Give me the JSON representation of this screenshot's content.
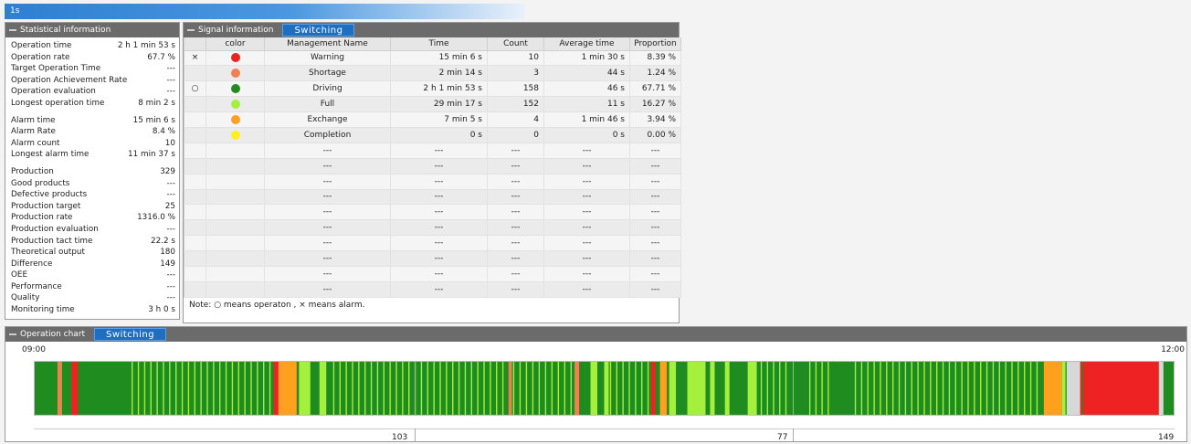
{
  "topbar": {
    "label": "1s"
  },
  "stats": {
    "title": "Statistical information",
    "rows": [
      {
        "label": "Operation time",
        "value": "2 h 1 min 53 s"
      },
      {
        "label": "Operation rate",
        "value": "67.7 %"
      },
      {
        "label": "Target Operation Time",
        "value": "---"
      },
      {
        "label": "Operation Achievement Rate",
        "value": "---"
      },
      {
        "label": "Operation evaluation",
        "value": "---"
      },
      {
        "label": "Longest operation time",
        "value": "8 min 2 s"
      },
      {
        "label": "Alarm time",
        "value": "15 min 6 s"
      },
      {
        "label": "Alarm Rate",
        "value": "8.4 %"
      },
      {
        "label": "Alarm count",
        "value": "10"
      },
      {
        "label": "Longest alarm time",
        "value": "11 min 37 s"
      },
      {
        "label": "Production",
        "value": "329"
      },
      {
        "label": "Good products",
        "value": "---"
      },
      {
        "label": "Defective products",
        "value": "---"
      },
      {
        "label": "Production target",
        "value": "25"
      },
      {
        "label": "Production rate",
        "value": "1316.0 %"
      },
      {
        "label": "Production evaluation",
        "value": "---"
      },
      {
        "label": "Production tact time",
        "value": "22.2 s"
      },
      {
        "label": "Theoretical output",
        "value": "180"
      },
      {
        "label": "Difference",
        "value": "149"
      },
      {
        "label": "OEE",
        "value": "---"
      },
      {
        "label": "Performance",
        "value": "---"
      },
      {
        "label": "Quality",
        "value": "---"
      },
      {
        "label": "Monitoring time",
        "value": "3 h 0 s"
      }
    ]
  },
  "signal": {
    "title": "Signal information",
    "switch_label": "Switching",
    "headers": [
      "",
      "color",
      "Management Name",
      "Time",
      "Count",
      "Average time",
      "Proportion"
    ],
    "rows": [
      {
        "mark": "×",
        "color": "#ee2222",
        "name": "Warning",
        "time": "15 min 6 s",
        "count": "10",
        "avg": "1 min 30 s",
        "prop": "8.39 %"
      },
      {
        "mark": "",
        "color": "#f08050",
        "name": "Shortage",
        "time": "2 min 14 s",
        "count": "3",
        "avg": "44 s",
        "prop": "1.24 %"
      },
      {
        "mark": "○",
        "color": "#1e8c1e",
        "name": "Driving",
        "time": "2 h 1 min 53 s",
        "count": "158",
        "avg": "46 s",
        "prop": "67.71 %"
      },
      {
        "mark": "",
        "color": "#a4f03c",
        "name": "Full",
        "time": "29 min 17 s",
        "count": "152",
        "avg": "11 s",
        "prop": "16.27 %"
      },
      {
        "mark": "",
        "color": "#ffa01e",
        "name": "Exchange",
        "time": "7 min 5 s",
        "count": "4",
        "avg": "1 min 46 s",
        "prop": "3.94 %"
      },
      {
        "mark": "",
        "color": "#ffee22",
        "name": "Completion",
        "time": "0 s",
        "count": "0",
        "avg": "0 s",
        "prop": "0.00 %"
      }
    ],
    "empty_cell": "---",
    "empty_rows": 10,
    "note": "Note: ○ means operaton , × means alarm."
  },
  "chart": {
    "title": "Operation chart",
    "switch_label": "Switching",
    "start_time": "09:00",
    "end_time": "12:00",
    "counts": [
      "103",
      "77",
      "149"
    ],
    "colors": {
      "driving": "#1e8c1e",
      "full": "#a4f03c",
      "warning": "#ee2222",
      "shortage": "#f08050",
      "exchange": "#ffa01e",
      "idle": "#d8d8d8"
    }
  }
}
